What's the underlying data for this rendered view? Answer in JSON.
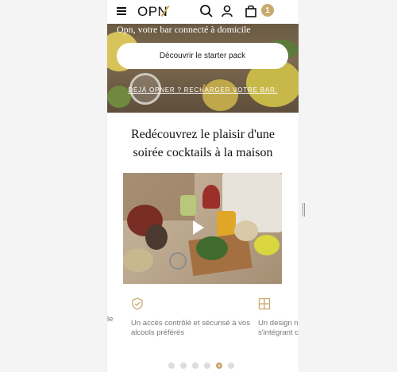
{
  "header": {
    "logo": "OPN",
    "cart_count": "1"
  },
  "hero": {
    "tagline": "Opn, votre bar connecté à domicile",
    "cta_label": "Découvrir le starter pack",
    "link_label": "DÉJÀ OPNER ? RECHARGER VOTRE BAR."
  },
  "section": {
    "title": "Redécouvrez le plaisir d'une soirée cocktails à la maison"
  },
  "features": [
    {
      "icon": "shield-check-icon",
      "text": "Un accès contrôlé et sécurisé à vos alcools préférés"
    },
    {
      "icon": "layout-icon",
      "text": "Un design n s'intégrant c"
    }
  ],
  "features_prev_fragment": "le",
  "carousel": {
    "dot_count": 6,
    "active_index": 4
  },
  "colors": {
    "accent": "#c9a96e",
    "text": "#111111",
    "muted": "#777777"
  }
}
